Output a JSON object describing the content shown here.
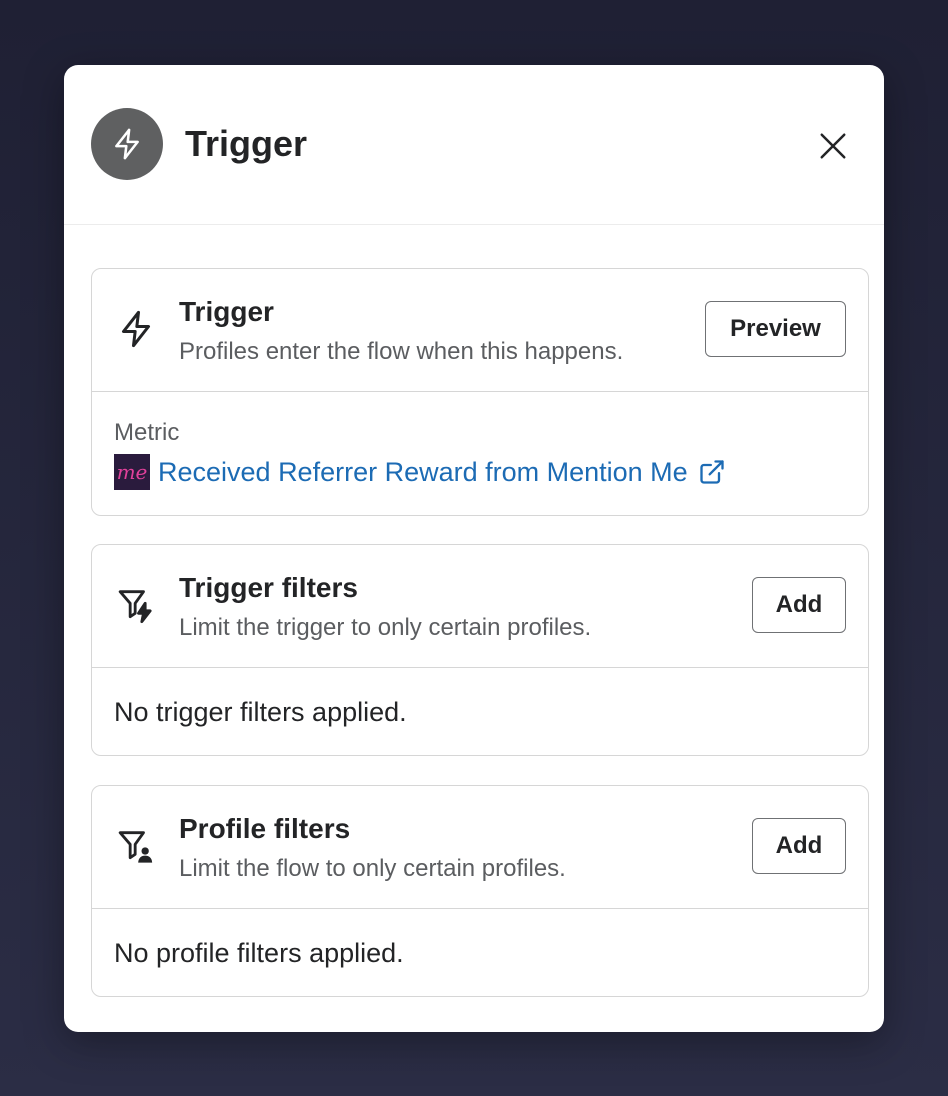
{
  "modal": {
    "title": "Trigger",
    "header_icon": "lightning-icon",
    "close_icon": "close-icon"
  },
  "trigger_card": {
    "title": "Trigger",
    "subtitle": "Profiles enter the flow when this happens.",
    "icon": "lightning-icon",
    "button_label": "Preview",
    "metric_label": "Metric",
    "metric_logo_text": "me",
    "metric_name": "Received Referrer Reward from Mention Me",
    "external_icon": "external-link-icon"
  },
  "trigger_filters_card": {
    "title": "Trigger filters",
    "subtitle": "Limit the trigger to only certain profiles.",
    "icon": "filter-lightning-icon",
    "button_label": "Add",
    "empty_text": "No trigger filters applied."
  },
  "profile_filters_card": {
    "title": "Profile filters",
    "subtitle": "Limit the flow to only certain profiles.",
    "icon": "filter-person-icon",
    "button_label": "Add",
    "empty_text": "No profile filters applied."
  },
  "colors": {
    "link": "#1c6bb4",
    "header_icon_bg": "#5f6061",
    "metric_logo_bg": "#2a1b3d",
    "metric_logo_text": "#e0409a"
  }
}
